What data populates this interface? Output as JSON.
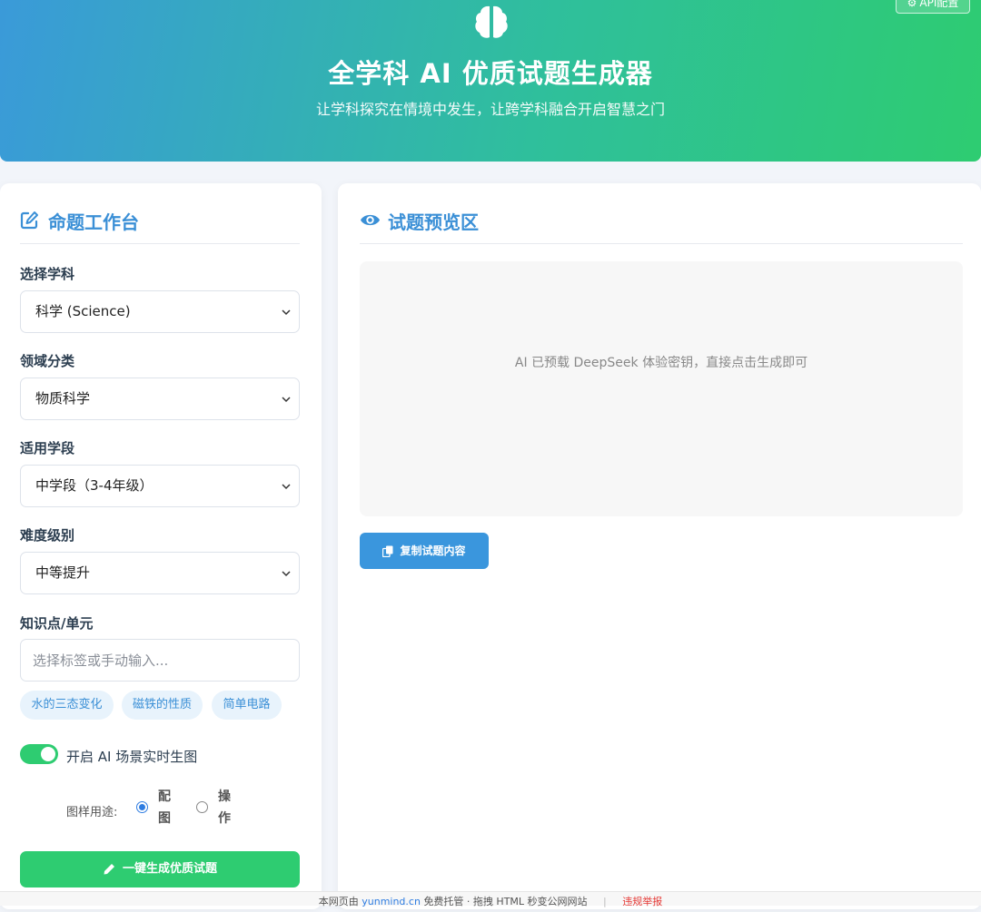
{
  "header": {
    "brain_icon": "brain-icon",
    "api_button_label": "API配置",
    "title": "全学科 AI 优质试题生成器",
    "subtitle": "让学科探究在情境中发生，让跨学科融合开启智慧之门"
  },
  "workbench": {
    "title": "命题工作台",
    "icon": "edit-icon",
    "subject": {
      "label": "选择学科",
      "value": "科学 (Science)"
    },
    "domain": {
      "label": "领域分类",
      "value": "物质科学"
    },
    "grade": {
      "label": "适用学段",
      "value": "中学段（3-4年级）"
    },
    "difficulty": {
      "label": "难度级别",
      "value": "中等提升"
    },
    "knowledge": {
      "label": "知识点/单元",
      "placeholder": "选择标签或手动输入...",
      "tags": [
        "水的三态变化",
        "磁铁的性质",
        "简单电路"
      ]
    },
    "ai_image_toggle": {
      "label": "开启 AI 场景实时生图",
      "enabled": true
    },
    "image_usage": {
      "label": "图样用途:",
      "options": [
        "配图",
        "操作"
      ],
      "selected": "配图"
    },
    "generate_button": "一键生成优质试题"
  },
  "preview": {
    "title": "试题预览区",
    "icon": "eye-icon",
    "placeholder": "AI 已预载 DeepSeek 体验密钥，直接点击生成即可",
    "copy_button": "复制试题内容"
  },
  "footer": {
    "prefix": "本网页由",
    "link": "yunmind.cn",
    "suffix": "免费托管 · 拖拽 HTML 秒变公网网站",
    "report": "违规举报"
  },
  "colors": {
    "accent_blue": "#3a8fd6",
    "accent_green": "#2ecc71",
    "report_red": "#e53935"
  }
}
